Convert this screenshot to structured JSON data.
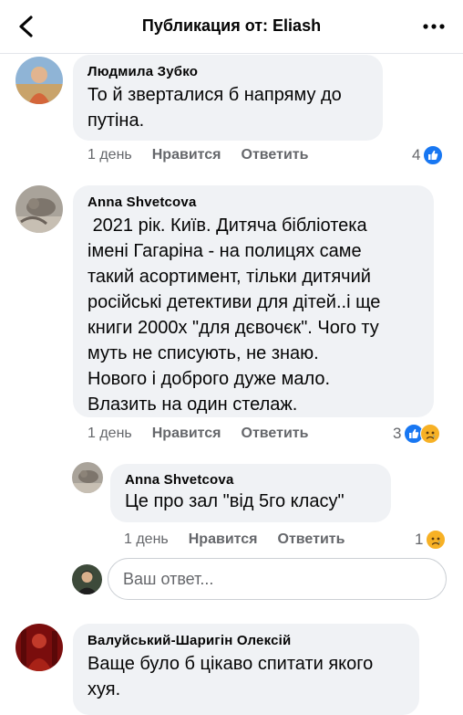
{
  "header": {
    "title": "Публикация от: Eliash"
  },
  "comments": [
    {
      "author": "Людмила Зубко",
      "text": "То й зверталися б напряму до\nпутіна.",
      "time": "1 день",
      "like_label": "Нравится",
      "reply_label": "Ответить",
      "reaction_count": "4",
      "reactions": [
        "like-icon"
      ]
    },
    {
      "author": "Anna Shvetcova",
      "text": " 2021 рік. Київ. Дитяча бібліотека\nімені Гагаріна - на полицях саме\nтакий асортимент, тільки дитячий\nросійські детективи для дітей..і ще\nкниги 2000х \"для дєвочєк\". Чого ту\nмуть не списують, не знаю.\nНового і доброго дуже мало.\nВлазить на один стелаж.",
      "time": "1 день",
      "like_label": "Нравится",
      "reply_label": "Ответить",
      "reaction_count": "3",
      "reactions": [
        "like-icon",
        "sad-icon"
      ]
    },
    {
      "author": "Anna Shvetcova",
      "text": "Це про зал \"від 5го класу\"",
      "time": "1 день",
      "like_label": "Нравится",
      "reply_label": "Ответить",
      "reaction_count": "1",
      "reactions": [
        "sad-icon"
      ]
    },
    {
      "author": "Валуйський-Шаригін Олексій",
      "text": "Ваще було б цікаво спитати якого\nхуя."
    }
  ],
  "reply_box": {
    "placeholder": "Ваш ответ..."
  },
  "colors": {
    "like_blue": "#1877f2",
    "sad_yellow": "#f7b125",
    "muted": "#65676b",
    "bubble": "#f0f2f5"
  }
}
